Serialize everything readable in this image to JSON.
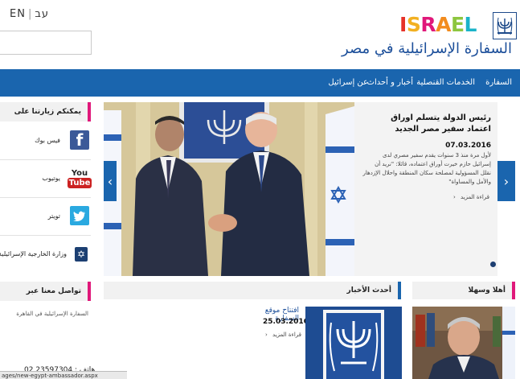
{
  "header": {
    "lang_he": "עב",
    "lang_en": "EN",
    "logo_letters": [
      {
        "ch": "I",
        "color": "#e63229"
      },
      {
        "ch": "S",
        "color": "#f2b021"
      },
      {
        "ch": "R",
        "color": "#e0187a"
      },
      {
        "ch": "A",
        "color": "#f28c1e"
      },
      {
        "ch": "E",
        "color": "#8dc63f"
      },
      {
        "ch": "L",
        "color": "#1ab3c9"
      }
    ],
    "site_title": "السفارة الإسرائيلية في مصر"
  },
  "nav": {
    "items": [
      "السفارة",
      "الخدمات القنصلية",
      "أخبار و أحداث",
      "عن إسرائيل"
    ]
  },
  "sidebar": {
    "follow_title": "يمكنكم زيارتنا على",
    "social": [
      {
        "label": "فيس بوك",
        "icon": "facebook-icon",
        "color": "#3b5998",
        "glyph": "f"
      },
      {
        "label": "يوتيوب",
        "icon": "youtube-icon",
        "color": "#cc2222",
        "glyph": "You\nTube"
      },
      {
        "label": "تويتر",
        "icon": "twitter-icon",
        "color": "#2aa9e0",
        "glyph": "t"
      },
      {
        "label": "وزارة الخارجية الإسرائيلية",
        "icon": "mfa-icon",
        "color": "#ffffff",
        "glyph": "✡"
      }
    ],
    "contact_title": "تواصل معنا عبر",
    "contact_line": "السفارة الإسرائيلية في القاهرة",
    "phone": "02 23597304 : هاتف"
  },
  "hero": {
    "headline": "رئيس الدولة يتسلم اوراق اعتماد سفير مصر الجديد",
    "date": "07.03.2016",
    "summary": "لأول مرة منذ 3 سنوات يقدم سفير مصري لدى إسرائيل حازم خيرت أوراق اعتماده، قائلا: \"نريد أن نقلل المسؤولية لمصلحة سكان المنطقة واحلال الإزدهار والأمل والمساواة\"",
    "read_more": "قراءة المزيد"
  },
  "news": {
    "section_title": "أحدث الأخبار",
    "item_title": "افتتاح موقع السفارة",
    "item_date": "25.03.2016",
    "read_more": "قراءة المزيد"
  },
  "welcome": {
    "section_title": "أهلا وسهلا"
  },
  "status_bar": {
    "url": "ages/new-egypt-ambassador.aspx"
  }
}
